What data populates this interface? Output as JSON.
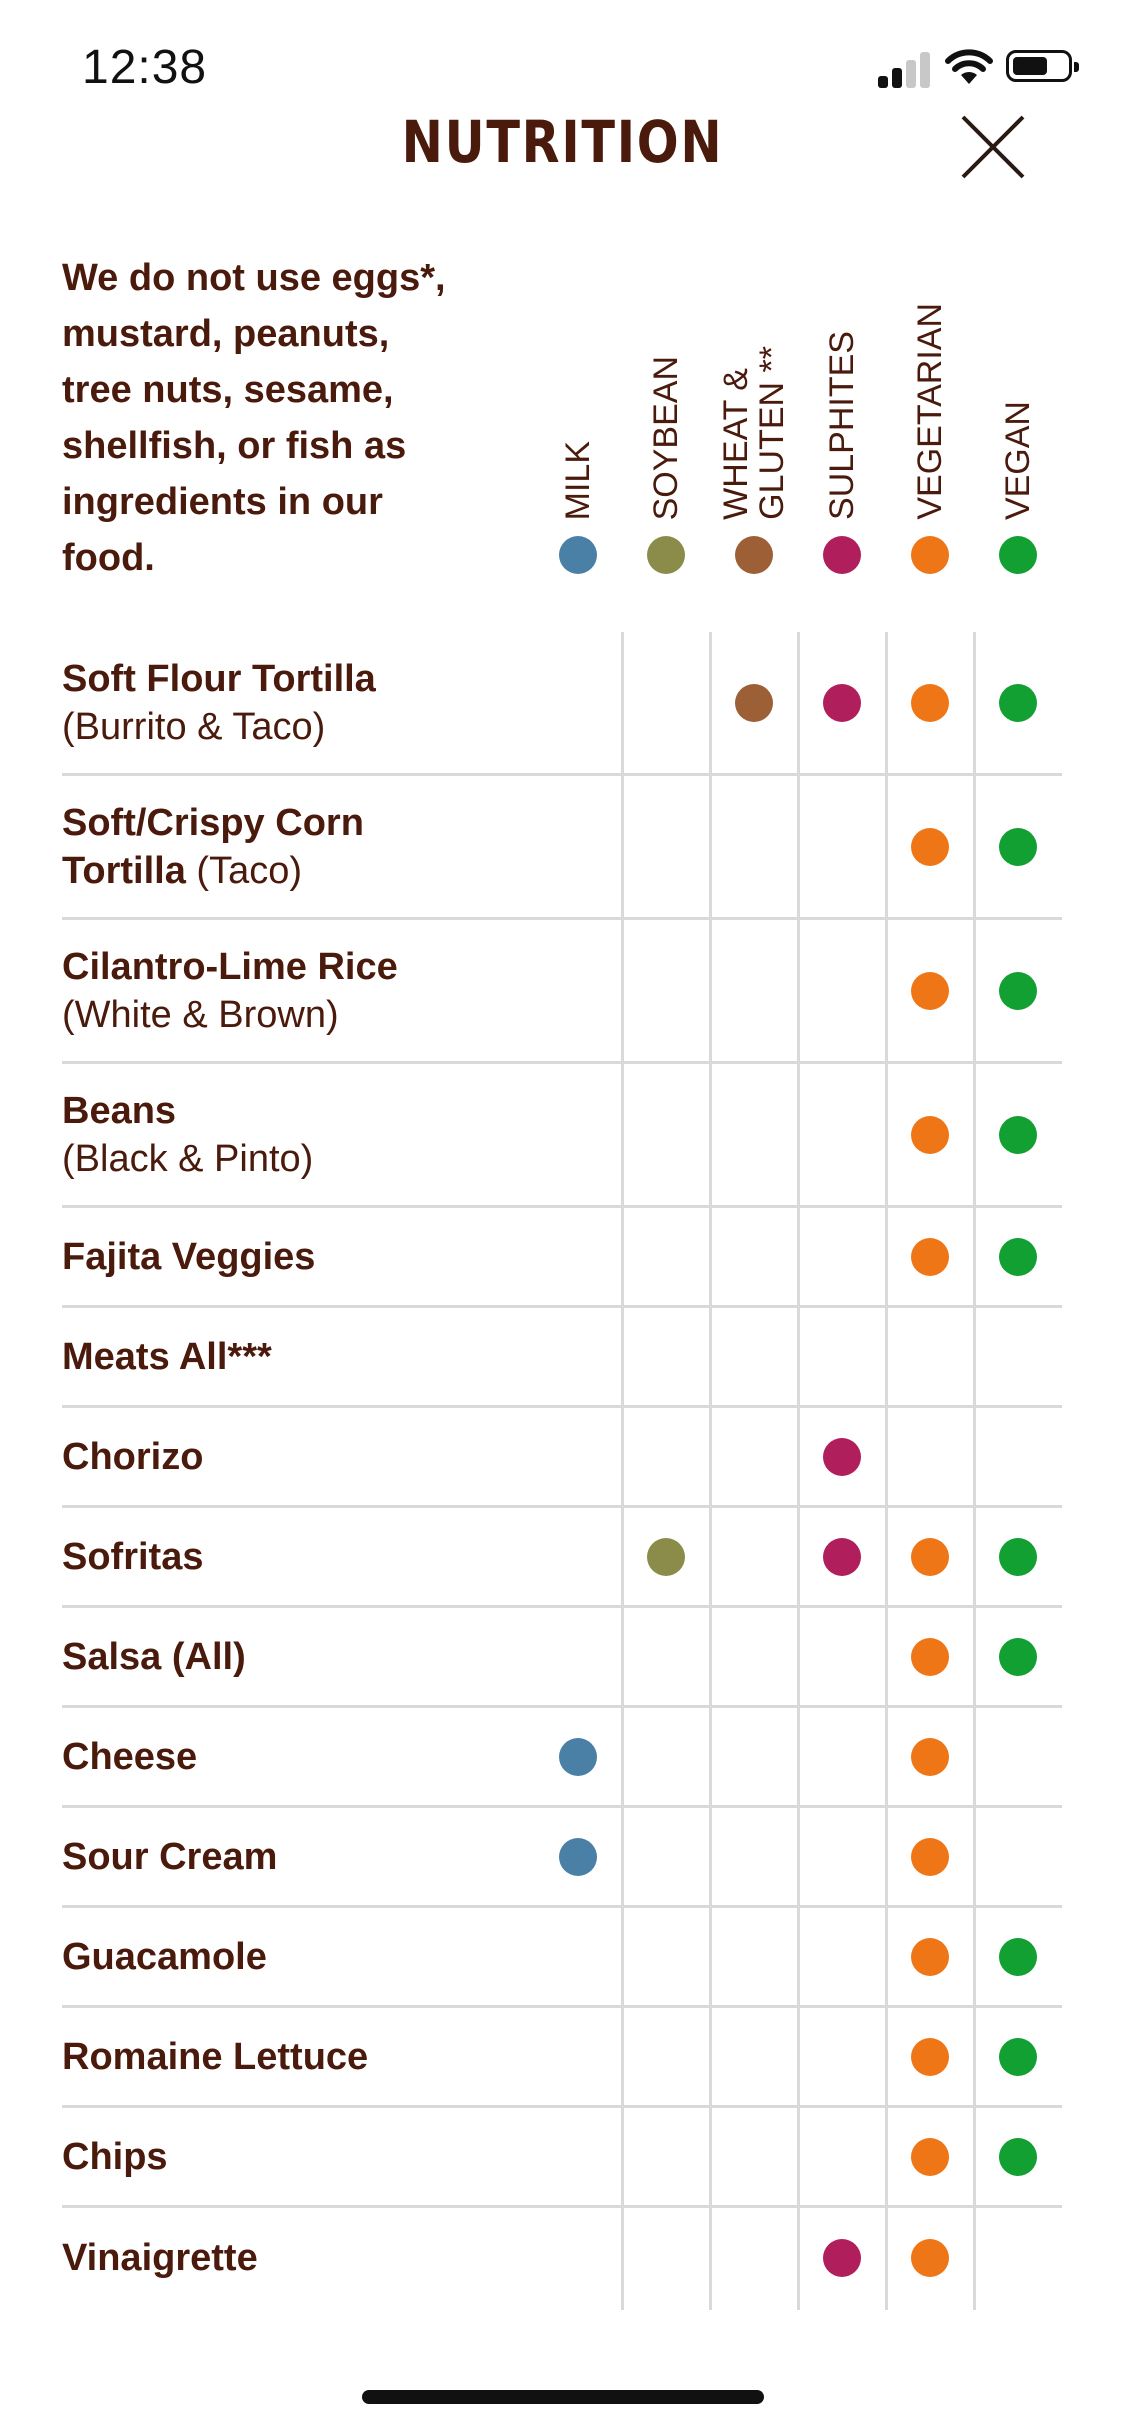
{
  "status": {
    "time": "12:38"
  },
  "header": {
    "title": "NUTRITION"
  },
  "intro": "We do not use eggs*, mustard, peanuts, tree nuts, sesame, shellfish, or fish as ingredients in our food.",
  "colors": {
    "milk": "#4a7fa6",
    "soybean": "#8b8b4a",
    "wheat": "#9c5f36",
    "sulphites": "#b01e5c",
    "vegetarian": "#ee7617",
    "vegan": "#13a033",
    "text": "#4a1a0c"
  },
  "columns": [
    {
      "key": "milk",
      "label": "MILK",
      "color": "#4a7fa6"
    },
    {
      "key": "soybean",
      "label": "SOYBEAN",
      "color": "#8b8b4a"
    },
    {
      "key": "wheat",
      "label": "WHEAT &\nGLUTEN **",
      "color": "#9c5f36"
    },
    {
      "key": "sulphites",
      "label": "SULPHITES",
      "color": "#b01e5c"
    },
    {
      "key": "vegetarian",
      "label": "VEGETARIAN",
      "color": "#ee7617"
    },
    {
      "key": "vegan",
      "label": "VEGAN",
      "color": "#13a033"
    }
  ],
  "rows": [
    {
      "bold": "Soft Flour Tortilla",
      "rest": "(Burrito & Taco)",
      "break": true,
      "marks": [
        0,
        0,
        1,
        1,
        1,
        1
      ]
    },
    {
      "bold": "Soft/Crispy Corn Tortilla",
      "rest": " (Taco)",
      "break": false,
      "marks": [
        0,
        0,
        0,
        0,
        1,
        1
      ]
    },
    {
      "bold": "Cilantro-Lime Rice",
      "rest": "(White & Brown)",
      "break": true,
      "marks": [
        0,
        0,
        0,
        0,
        1,
        1
      ]
    },
    {
      "bold": "Beans",
      "rest": "(Black & Pinto)",
      "break": true,
      "marks": [
        0,
        0,
        0,
        0,
        1,
        1
      ]
    },
    {
      "bold": "Fajita Veggies",
      "rest": "",
      "break": false,
      "marks": [
        0,
        0,
        0,
        0,
        1,
        1
      ]
    },
    {
      "bold": "Meats All***",
      "rest": "",
      "break": false,
      "marks": [
        0,
        0,
        0,
        0,
        0,
        0
      ]
    },
    {
      "bold": "Chorizo",
      "rest": "",
      "break": false,
      "marks": [
        0,
        0,
        0,
        1,
        0,
        0
      ]
    },
    {
      "bold": "Sofritas",
      "rest": "",
      "break": false,
      "marks": [
        0,
        1,
        0,
        1,
        1,
        1
      ]
    },
    {
      "bold": "Salsa (All)",
      "rest": "",
      "break": false,
      "marks": [
        0,
        0,
        0,
        0,
        1,
        1
      ]
    },
    {
      "bold": "Cheese",
      "rest": "",
      "break": false,
      "marks": [
        1,
        0,
        0,
        0,
        1,
        0
      ]
    },
    {
      "bold": "Sour Cream",
      "rest": "",
      "break": false,
      "marks": [
        1,
        0,
        0,
        0,
        1,
        0
      ]
    },
    {
      "bold": "Guacamole",
      "rest": "",
      "break": false,
      "marks": [
        0,
        0,
        0,
        0,
        1,
        1
      ]
    },
    {
      "bold": "Romaine Lettuce",
      "rest": "",
      "break": false,
      "marks": [
        0,
        0,
        0,
        0,
        1,
        1
      ]
    },
    {
      "bold": "Chips",
      "rest": "",
      "break": false,
      "marks": [
        0,
        0,
        0,
        0,
        1,
        1
      ]
    },
    {
      "bold": "Vinaigrette",
      "rest": "",
      "break": false,
      "marks": [
        0,
        0,
        0,
        1,
        1,
        0
      ]
    }
  ]
}
